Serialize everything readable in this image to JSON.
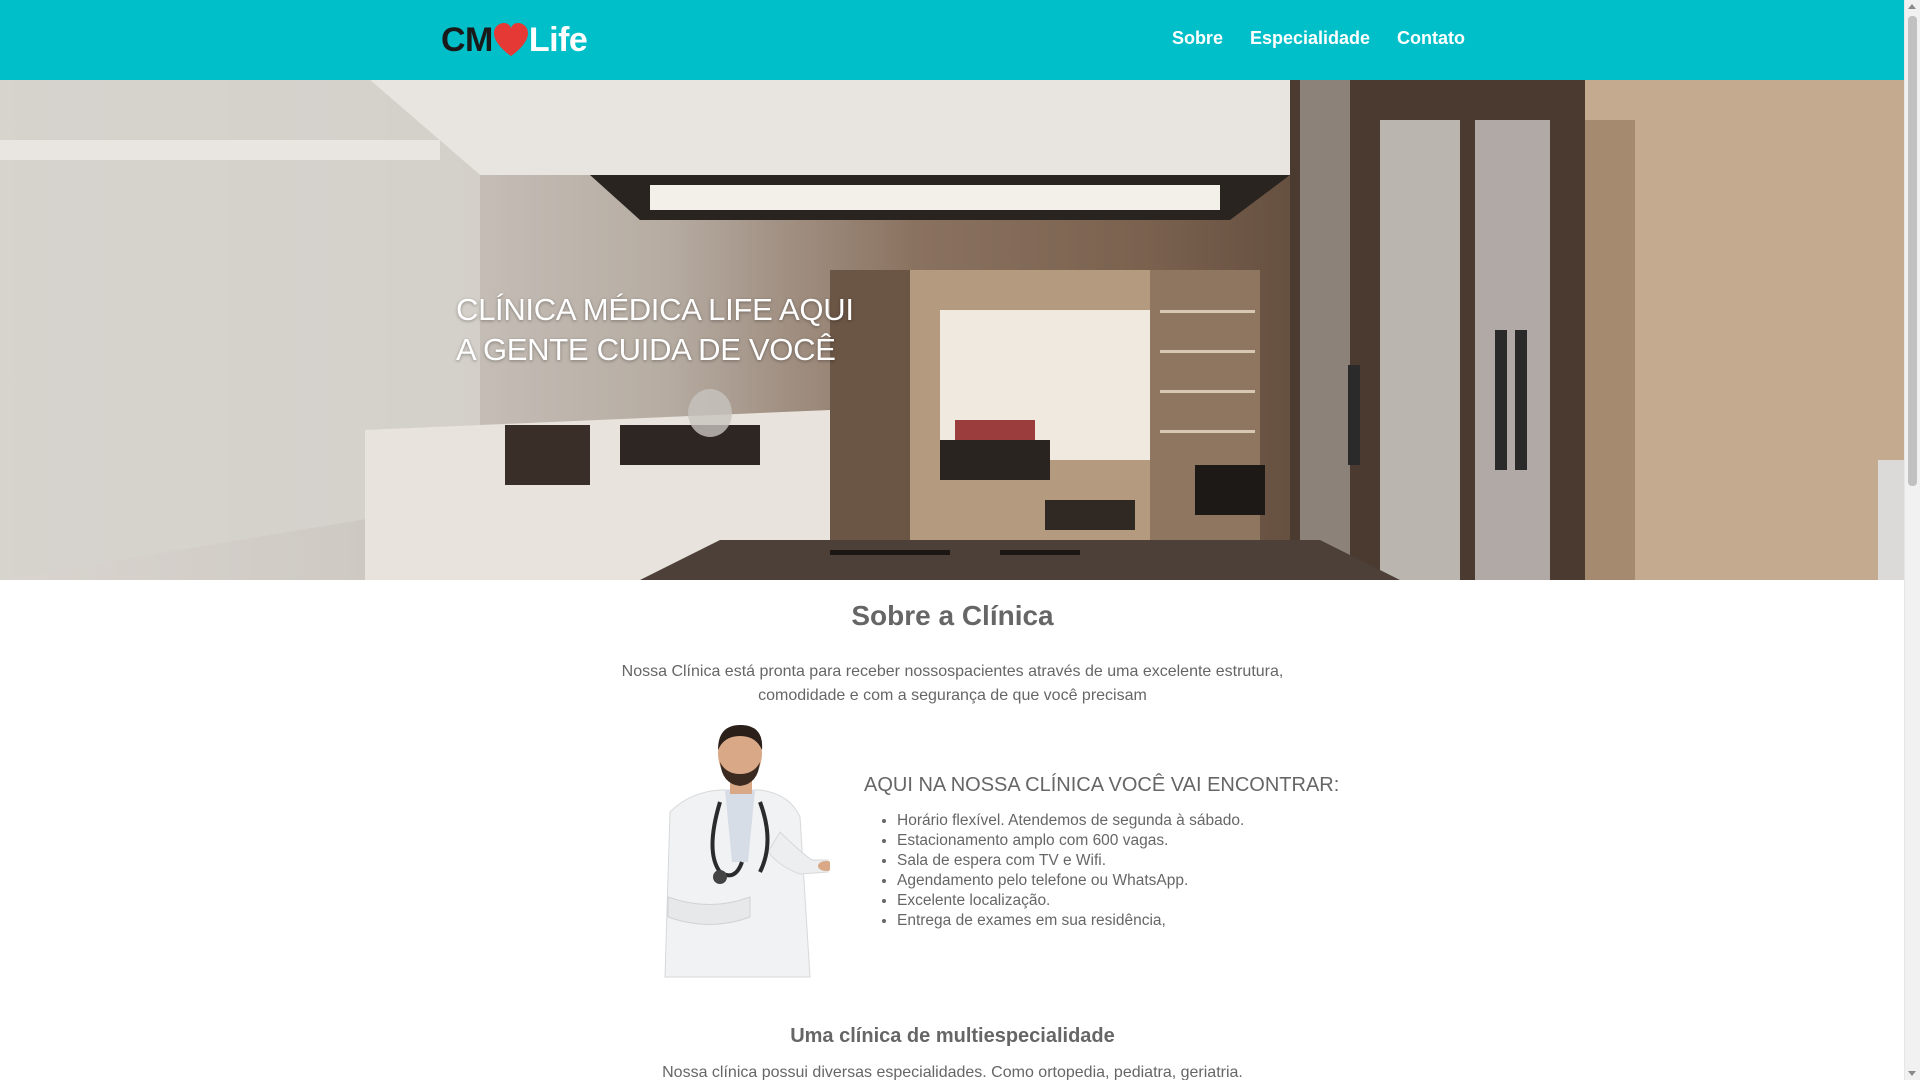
{
  "brand": {
    "logo_left": "CM",
    "logo_right": "Life",
    "heart_color": "#e53935",
    "header_color": "#00bfc8"
  },
  "nav": {
    "items": [
      "Sobre",
      "Especialidade",
      "Contato"
    ]
  },
  "hero": {
    "line1": "CLÍNICA MÉDICA LIFE AQUI",
    "line2": "A GENTE CUIDA DE VOCÊ"
  },
  "about": {
    "title": "Sobre a Clínica",
    "description": "Nossa Clínica está pronta para receber nossospacientes através de uma excelente estrutura, comodidade e com a segurança de que você precisam"
  },
  "features": {
    "title": "AQUI NA NOSSA CLÍNICA VOCÊ VAI ENCONTRAR:",
    "items": [
      "Horário flexível. Atendemos de segunda à sábado.",
      "Estacionamento amplo com 600 vagas.",
      "Sala de espera com TV e Wifi.",
      "Agendamento pelo telefone ou WhatsApp.",
      "Excelente localização.",
      "Entrega de exames em sua residência,"
    ]
  },
  "multi": {
    "title": "Uma clínica de multiespecialidade",
    "description": "Nossa clínica possui diversas especialidades. Como ortopedia, pediatra, geriatria."
  }
}
